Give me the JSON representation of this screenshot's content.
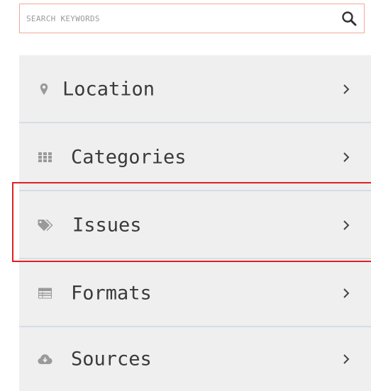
{
  "search": {
    "placeholder": "SEARCH KEYWORDS",
    "value": ""
  },
  "menu": {
    "items": [
      {
        "label": "Location",
        "icon": "map-pin-icon"
      },
      {
        "label": "Categories",
        "icon": "grid-icon"
      },
      {
        "label": "Issues",
        "icon": "tags-icon"
      },
      {
        "label": "Formats",
        "icon": "table-icon"
      },
      {
        "label": "Sources",
        "icon": "cloud-download-icon"
      }
    ],
    "chevron_icon": "chevron-right-icon",
    "highlighted_item": "Issues"
  },
  "colors": {
    "search_border": "#f3a89a",
    "menu_background": "#efefef",
    "divider": "#d7dce6",
    "icon": "#9a9a9a",
    "label": "#3a3a3a",
    "highlight": "#e02020"
  }
}
